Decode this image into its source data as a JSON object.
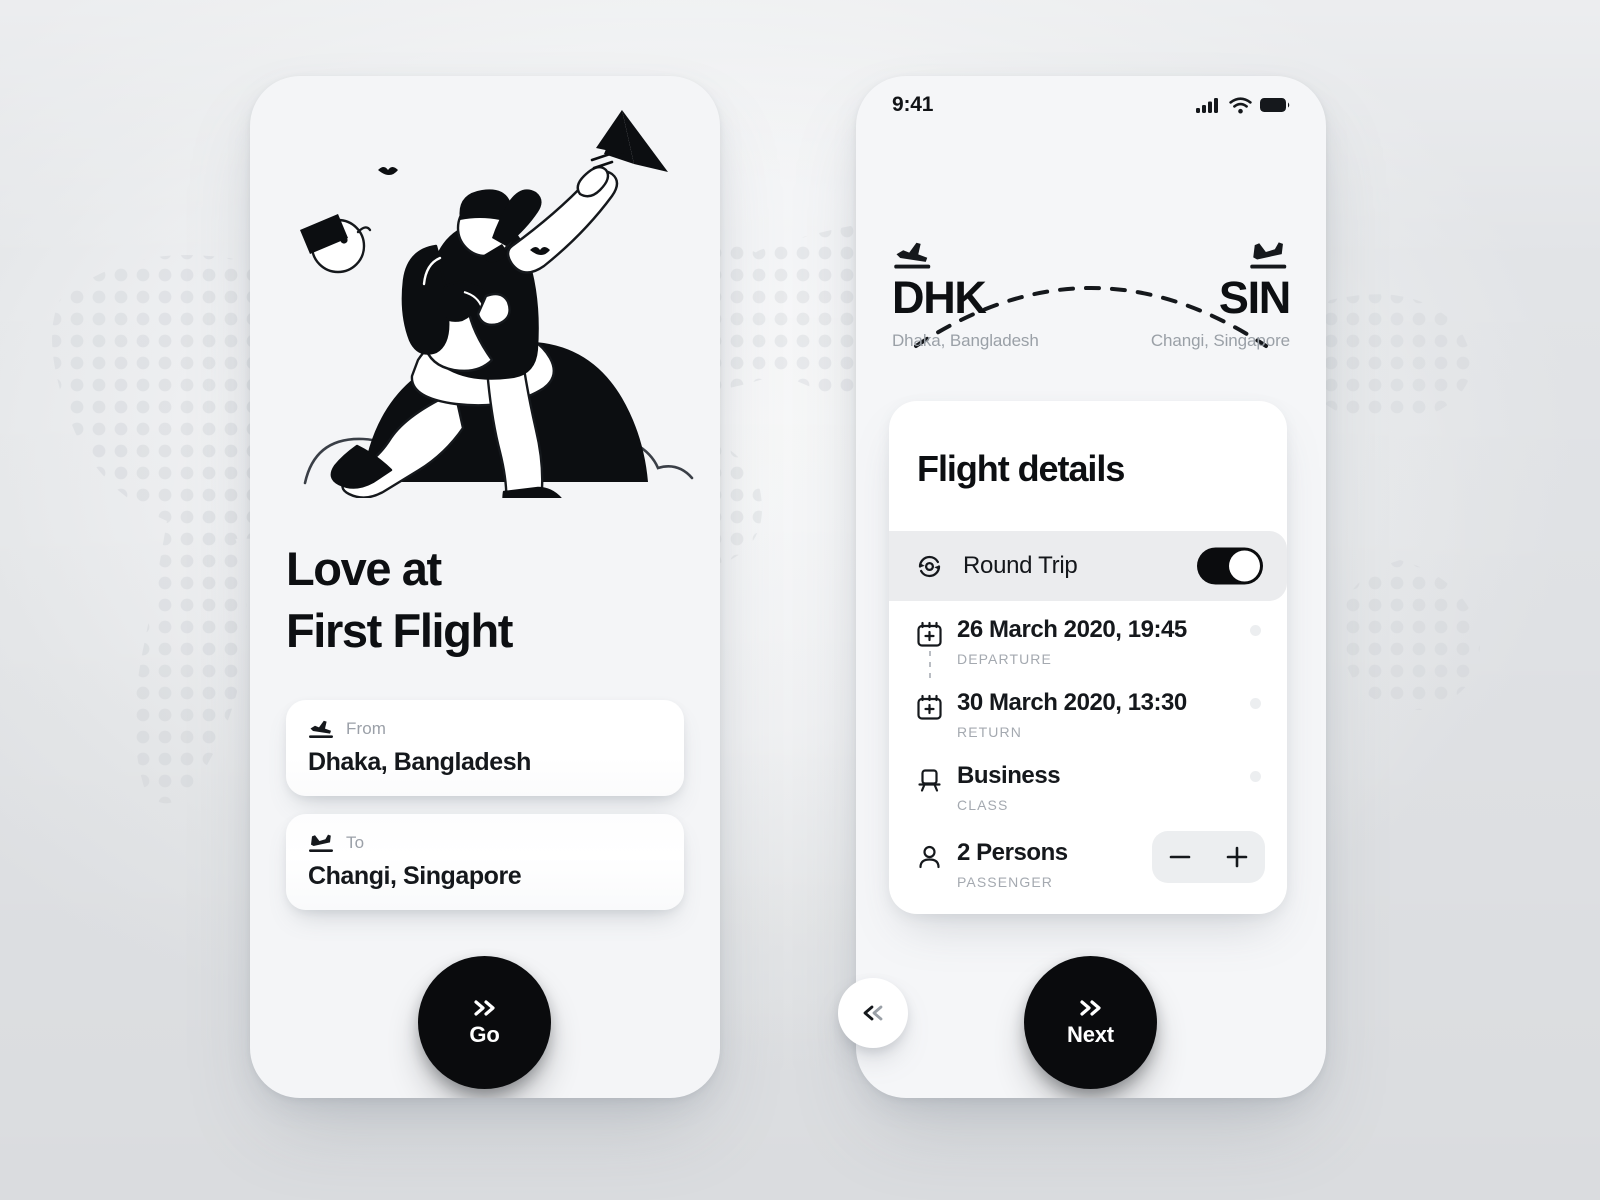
{
  "background": {
    "accent_dark": "#0a0b0d",
    "surface": "#f4f5f7",
    "page": "#eceef0",
    "muted_text": "#9ba0a8"
  },
  "left_screen": {
    "headline_line1": "Love at",
    "headline_line2": "First Flight",
    "illustration_name": "person-reaching-for-paper-plane",
    "from_field": {
      "icon": "plane-takeoff-icon",
      "label": "From",
      "value": "Dhaka, Bangladesh",
      "placeholder": "From"
    },
    "to_field": {
      "icon": "plane-landing-icon",
      "label": "To",
      "value": "Changi, Singapore",
      "placeholder": "To"
    },
    "cta": {
      "label": "Go",
      "icon": "double-chevron-right-icon"
    }
  },
  "right_screen": {
    "status_bar": {
      "time": "9:41",
      "icons": [
        "cellular-signal-icon",
        "wifi-icon",
        "battery-icon"
      ]
    },
    "route": {
      "origin": {
        "code": "DHK",
        "city": "Dhaka, Bangladesh",
        "icon": "plane-takeoff-icon"
      },
      "destination": {
        "code": "SIN",
        "city": "Changi, Singapore",
        "icon": "plane-landing-icon"
      },
      "path_style": "dashed-arc"
    },
    "card": {
      "title": "Flight details",
      "round_trip": {
        "icon": "round-trip-loop-icon",
        "label": "Round Trip",
        "toggle_on": true
      },
      "rows": [
        {
          "icon": "calendar-plus-icon",
          "main": "26 March 2020, 19:45",
          "sub": "DEPARTURE"
        },
        {
          "icon": "calendar-plus-icon",
          "main": "30 March 2020, 13:30",
          "sub": "RETURN"
        },
        {
          "icon": "seat-icon",
          "main": "Business",
          "sub": "CLASS"
        },
        {
          "icon": "person-icon",
          "main": "2 Persons",
          "sub": "PASSENGER"
        }
      ],
      "stepper": {
        "decrement": "−",
        "increment": "+"
      }
    },
    "cta": {
      "label": "Next",
      "icon": "double-chevron-right-icon"
    },
    "back": {
      "icon": "double-chevron-left-icon"
    }
  }
}
